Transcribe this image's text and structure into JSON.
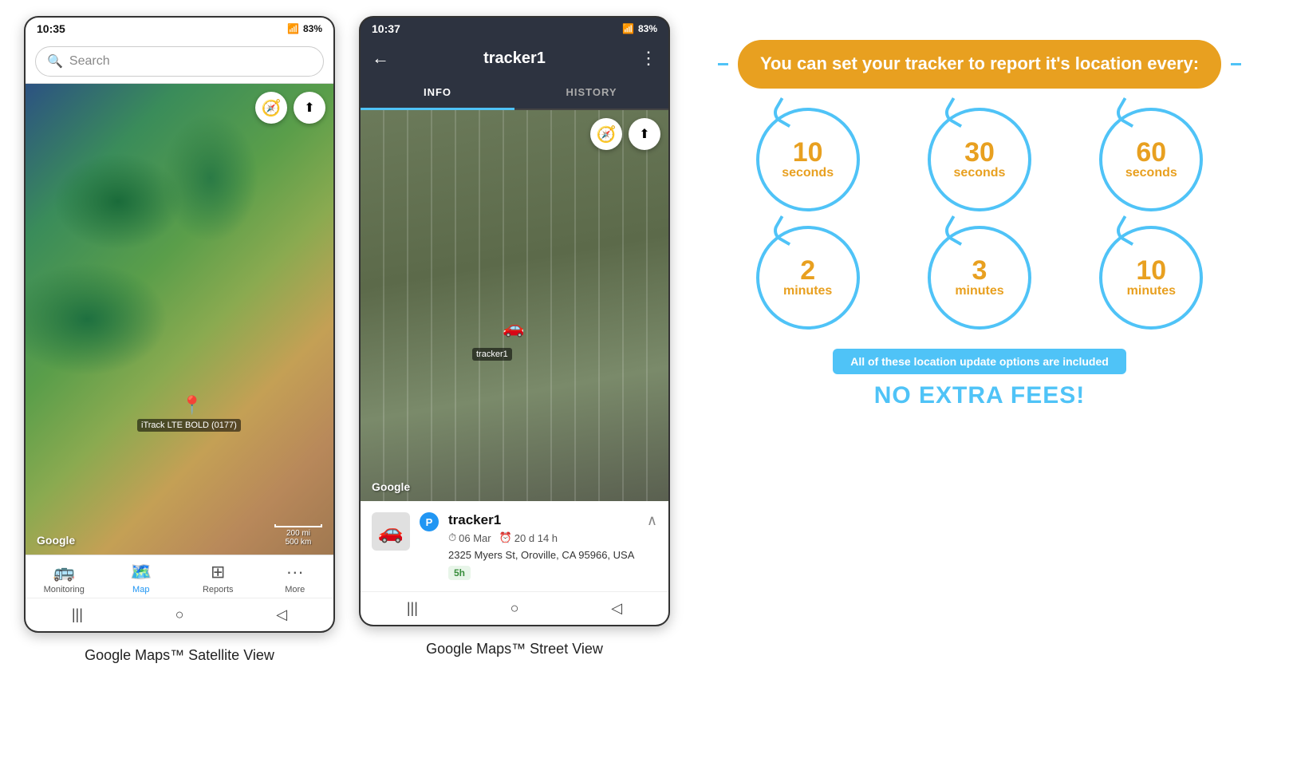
{
  "phone1": {
    "status_bar": {
      "time": "10:35",
      "battery": "83%",
      "signal": "▲▲▲"
    },
    "search": {
      "placeholder": "Search"
    },
    "map": {
      "tracker_label": "iTrack LTE BOLD (0177)",
      "google_watermark": "Google",
      "scale_200mi": "200 mi",
      "scale_500km": "500 km"
    },
    "nav": {
      "items": [
        {
          "id": "monitoring",
          "label": "Monitoring",
          "icon": "🚌"
        },
        {
          "id": "map",
          "label": "Map",
          "icon": "🗺",
          "active": true
        },
        {
          "id": "reports",
          "label": "Reports",
          "icon": "▦"
        },
        {
          "id": "more",
          "label": "More",
          "icon": "···"
        }
      ]
    },
    "caption": "Google Maps™ Satellite View"
  },
  "phone2": {
    "status_bar": {
      "time": "10:37",
      "battery": "83%",
      "signal": "▲▲▲"
    },
    "header": {
      "title": "tracker1",
      "back_icon": "←",
      "menu_icon": "⋮"
    },
    "tabs": [
      {
        "id": "info",
        "label": "INFO",
        "active": true
      },
      {
        "id": "history",
        "label": "HISTORY",
        "active": false
      }
    ],
    "tracker_info": {
      "name": "tracker1",
      "date": "06 Mar",
      "duration": "20 d 14 h",
      "address": "2325 Myers St, Oroville, CA 95966, USA",
      "badge": "5h"
    },
    "map": {
      "label": "tracker1",
      "google_watermark": "Google"
    },
    "caption": "Google Maps™ Street View"
  },
  "info_panel": {
    "headline": "You can set your tracker to report it's location every:",
    "circles": [
      {
        "id": "10s",
        "number": "10",
        "unit": "seconds"
      },
      {
        "id": "30s",
        "number": "30",
        "unit": "seconds"
      },
      {
        "id": "60s",
        "number": "60",
        "unit": "seconds"
      },
      {
        "id": "2m",
        "number": "2",
        "unit": "minutes"
      },
      {
        "id": "3m",
        "number": "3",
        "unit": "minutes"
      },
      {
        "id": "10m",
        "number": "10",
        "unit": "minutes"
      }
    ],
    "included_text": "All of these location update options are included",
    "no_fees_text": "NO EXTRA FEES!",
    "accent_color": "#e8a020",
    "blue_color": "#4fc3f7"
  }
}
